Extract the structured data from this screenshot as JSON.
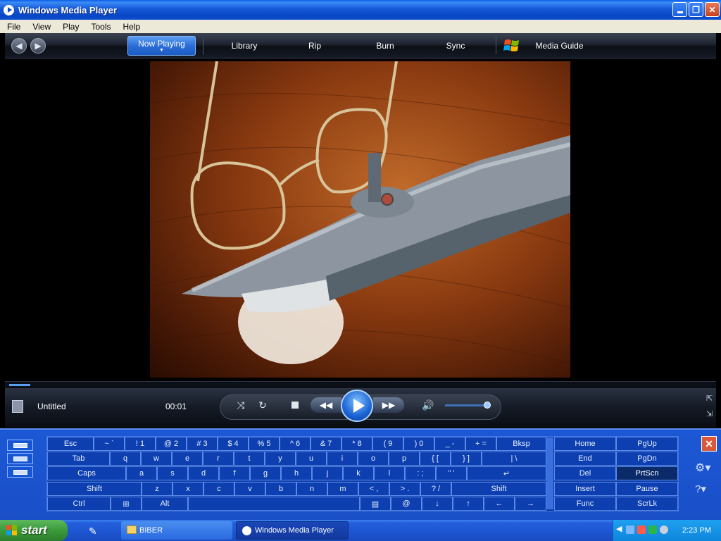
{
  "window": {
    "title": "Windows Media Player"
  },
  "menu": [
    "File",
    "View",
    "Play",
    "Tools",
    "Help"
  ],
  "nav": {
    "now_playing": "Now Playing",
    "library": "Library",
    "rip": "Rip",
    "burn": "Burn",
    "sync": "Sync",
    "media_guide": "Media Guide"
  },
  "now_playing": {
    "title": "Untitled",
    "time": "00:01",
    "seek_progress": 0.03,
    "volume_level": 0.9
  },
  "keyboard": {
    "row1": [
      "Esc",
      "~ `",
      "! 1",
      "@ 2",
      "# 3",
      "$ 4",
      "% 5",
      "^ 6",
      "& 7",
      "* 8",
      "( 9",
      ") 0",
      "_ -",
      "+ =",
      "Bksp"
    ],
    "row2": [
      "Tab",
      "q",
      "w",
      "e",
      "r",
      "t",
      "y",
      "u",
      "i",
      "o",
      "p",
      "{ [",
      "} ]",
      "| \\"
    ],
    "row3": [
      "Caps",
      "a",
      "s",
      "d",
      "f",
      "g",
      "h",
      "j",
      "k",
      "l",
      ": ;",
      "\" '"
    ],
    "row4": [
      "Shift",
      "z",
      "x",
      "c",
      "v",
      "b",
      "n",
      "m",
      "< ,",
      "> .",
      "? /",
      "Shift"
    ],
    "row5": [
      "Ctrl",
      "Alt",
      "@"
    ],
    "nav_keys": [
      "Home",
      "PgUp",
      "End",
      "PgDn",
      "Del",
      "PrtScn",
      "Insert",
      "Pause",
      "Func",
      "ScrLk"
    ]
  },
  "taskbar": {
    "start": "start",
    "buttons": [
      "BIBER",
      "Windows Media Player"
    ],
    "clock": "2:23 PM"
  }
}
